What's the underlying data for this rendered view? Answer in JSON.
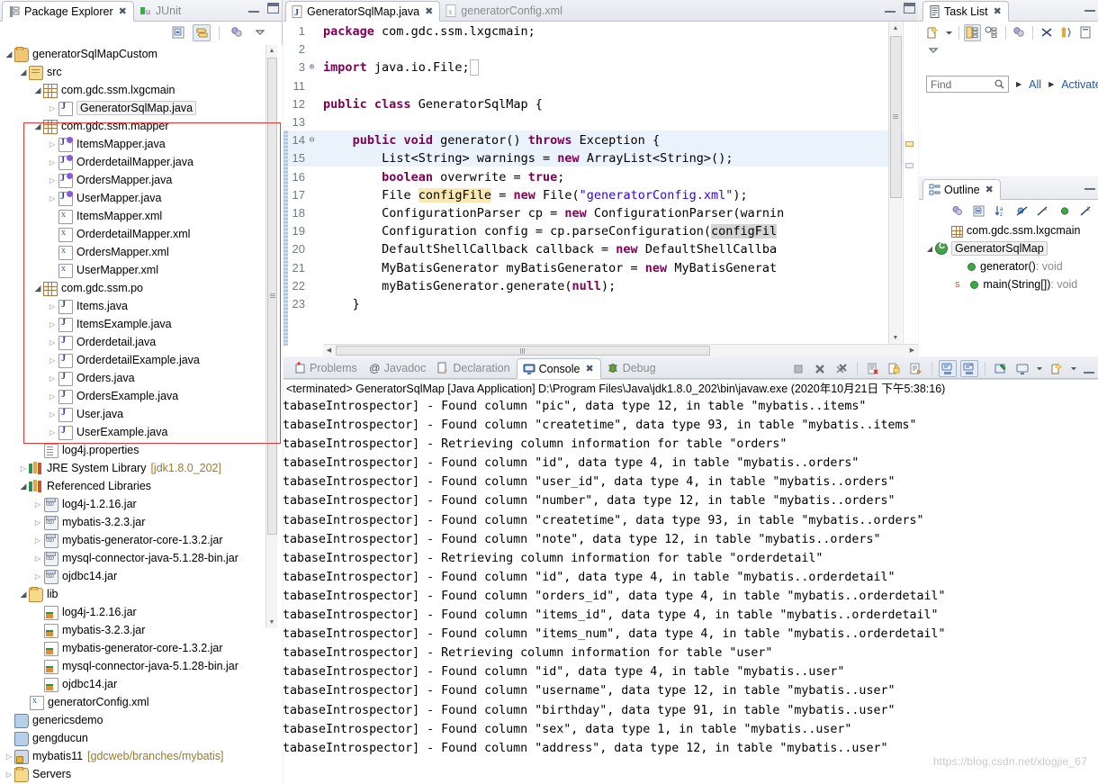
{
  "package_explorer": {
    "tabs": [
      {
        "label": "Package Explorer",
        "icon": "package-explorer-icon",
        "active": true
      },
      {
        "label": "JUnit",
        "icon": "junit-icon",
        "active": false
      }
    ],
    "toolbar": [
      {
        "name": "collapse-all-button",
        "icon": "collapse-all-icon"
      },
      {
        "name": "link-with-editor-button",
        "icon": "link-editor-icon"
      },
      {
        "name": "focus-on-active-task-button",
        "icon": "focus-task-icon"
      },
      {
        "name": "view-menu-button",
        "icon": "chevron-down-icon"
      }
    ],
    "tree": [
      {
        "depth": 0,
        "arrow": "open",
        "icon": "project-icon",
        "label": "generatorSqlMapCustom",
        "sub": ""
      },
      {
        "depth": 1,
        "arrow": "open",
        "icon": "source-folder-icon",
        "label": "src",
        "sub": ""
      },
      {
        "depth": 2,
        "arrow": "open",
        "icon": "package-icon",
        "label": "com.gdc.ssm.lxgcmain",
        "sub": ""
      },
      {
        "depth": 3,
        "arrow": "closed",
        "icon": "java-file-icon",
        "label": "GeneratorSqlMap.java",
        "sub": "",
        "selected": true
      },
      {
        "depth": 2,
        "arrow": "open",
        "icon": "package-icon",
        "label": "com.gdc.ssm.mapper",
        "sub": ""
      },
      {
        "depth": 3,
        "arrow": "closed",
        "icon": "java-interface-icon",
        "label": "ItemsMapper.java",
        "sub": ""
      },
      {
        "depth": 3,
        "arrow": "closed",
        "icon": "java-interface-icon",
        "label": "OrderdetailMapper.java",
        "sub": ""
      },
      {
        "depth": 3,
        "arrow": "closed",
        "icon": "java-interface-icon",
        "label": "OrdersMapper.java",
        "sub": ""
      },
      {
        "depth": 3,
        "arrow": "closed",
        "icon": "java-interface-icon",
        "label": "UserMapper.java",
        "sub": ""
      },
      {
        "depth": 3,
        "arrow": "none",
        "icon": "xml-file-icon",
        "label": "ItemsMapper.xml",
        "sub": ""
      },
      {
        "depth": 3,
        "arrow": "none",
        "icon": "xml-file-icon",
        "label": "OrderdetailMapper.xml",
        "sub": ""
      },
      {
        "depth": 3,
        "arrow": "none",
        "icon": "xml-file-icon",
        "label": "OrdersMapper.xml",
        "sub": ""
      },
      {
        "depth": 3,
        "arrow": "none",
        "icon": "xml-file-icon",
        "label": "UserMapper.xml",
        "sub": ""
      },
      {
        "depth": 2,
        "arrow": "open",
        "icon": "package-icon",
        "label": "com.gdc.ssm.po",
        "sub": ""
      },
      {
        "depth": 3,
        "arrow": "closed",
        "icon": "java-file-icon",
        "label": "Items.java",
        "sub": ""
      },
      {
        "depth": 3,
        "arrow": "closed",
        "icon": "java-file-icon",
        "label": "ItemsExample.java",
        "sub": ""
      },
      {
        "depth": 3,
        "arrow": "closed",
        "icon": "java-file-icon",
        "label": "Orderdetail.java",
        "sub": ""
      },
      {
        "depth": 3,
        "arrow": "closed",
        "icon": "java-file-icon",
        "label": "OrderdetailExample.java",
        "sub": ""
      },
      {
        "depth": 3,
        "arrow": "closed",
        "icon": "java-file-icon",
        "label": "Orders.java",
        "sub": ""
      },
      {
        "depth": 3,
        "arrow": "closed",
        "icon": "java-file-icon",
        "label": "OrdersExample.java",
        "sub": ""
      },
      {
        "depth": 3,
        "arrow": "closed",
        "icon": "java-file-icon",
        "label": "User.java",
        "sub": ""
      },
      {
        "depth": 3,
        "arrow": "closed",
        "icon": "java-file-icon",
        "label": "UserExample.java",
        "sub": ""
      },
      {
        "depth": 2,
        "arrow": "none",
        "icon": "properties-file-icon",
        "label": "log4j.properties",
        "sub": ""
      },
      {
        "depth": 1,
        "arrow": "closed",
        "icon": "library-icon",
        "label": "JRE System Library",
        "sub": "[jdk1.8.0_202]"
      },
      {
        "depth": 1,
        "arrow": "open",
        "icon": "library-icon",
        "label": "Referenced Libraries",
        "sub": ""
      },
      {
        "depth": 2,
        "arrow": "closed",
        "icon": "jar-icon",
        "label": "log4j-1.2.16.jar",
        "sub": ""
      },
      {
        "depth": 2,
        "arrow": "closed",
        "icon": "jar-icon",
        "label": "mybatis-3.2.3.jar",
        "sub": ""
      },
      {
        "depth": 2,
        "arrow": "closed",
        "icon": "jar-icon",
        "label": "mybatis-generator-core-1.3.2.jar",
        "sub": ""
      },
      {
        "depth": 2,
        "arrow": "closed",
        "icon": "jar-icon",
        "label": "mysql-connector-java-5.1.28-bin.jar",
        "sub": ""
      },
      {
        "depth": 2,
        "arrow": "closed",
        "icon": "jar-icon",
        "label": "ojdbc14.jar",
        "sub": ""
      },
      {
        "depth": 1,
        "arrow": "open",
        "icon": "folder-icon",
        "label": "lib",
        "sub": ""
      },
      {
        "depth": 2,
        "arrow": "none",
        "icon": "jar-file-icon",
        "label": "log4j-1.2.16.jar",
        "sub": ""
      },
      {
        "depth": 2,
        "arrow": "none",
        "icon": "jar-file-icon",
        "label": "mybatis-3.2.3.jar",
        "sub": ""
      },
      {
        "depth": 2,
        "arrow": "none",
        "icon": "jar-file-icon",
        "label": "mybatis-generator-core-1.3.2.jar",
        "sub": ""
      },
      {
        "depth": 2,
        "arrow": "none",
        "icon": "jar-file-icon",
        "label": "mysql-connector-java-5.1.28-bin.jar",
        "sub": ""
      },
      {
        "depth": 2,
        "arrow": "none",
        "icon": "jar-file-icon",
        "label": "ojdbc14.jar",
        "sub": ""
      },
      {
        "depth": 1,
        "arrow": "none",
        "icon": "xml-file-icon",
        "label": "generatorConfig.xml",
        "sub": ""
      },
      {
        "depth": 0,
        "arrow": "none",
        "icon": "closed-project-icon",
        "label": "genericsdemo",
        "sub": ""
      },
      {
        "depth": 0,
        "arrow": "none",
        "icon": "closed-project-icon",
        "label": "gengducun",
        "sub": ""
      },
      {
        "depth": 0,
        "arrow": "closed",
        "icon": "svn-project-icon",
        "label": "mybatis11",
        "sub": "[gdcweb/branches/mybatis]"
      },
      {
        "depth": 0,
        "arrow": "closed",
        "icon": "servers-folder-icon",
        "label": "Servers",
        "sub": ""
      }
    ]
  },
  "editor": {
    "tabs": [
      {
        "label": "GeneratorSqlMap.java",
        "icon": "java-file-icon",
        "active": true
      },
      {
        "label": "generatorConfig.xml",
        "icon": "xml-file-icon",
        "active": false
      }
    ],
    "lines": [
      {
        "no": "1",
        "fold": "",
        "text": "package com.gdc.ssm.lxgcmain;"
      },
      {
        "no": "2",
        "fold": "",
        "text": ""
      },
      {
        "no": "3",
        "fold": "+",
        "text": "import java.io.File;"
      },
      {
        "no": "11",
        "fold": "",
        "text": ""
      },
      {
        "no": "12",
        "fold": "",
        "text": "public class GeneratorSqlMap {"
      },
      {
        "no": "13",
        "fold": "",
        "text": ""
      },
      {
        "no": "14",
        "fold": "-",
        "text": "    public void generator() throws Exception {"
      },
      {
        "no": "15",
        "fold": "",
        "text": "        List<String> warnings = new ArrayList<String>();"
      },
      {
        "no": "16",
        "fold": "",
        "text": "        boolean overwrite = true;"
      },
      {
        "no": "17",
        "fold": "",
        "text": "        File configFile = new File(\"generatorConfig.xml\");"
      },
      {
        "no": "18",
        "fold": "",
        "text": "        ConfigurationParser cp = new ConfigurationParser(warnin"
      },
      {
        "no": "19",
        "fold": "",
        "text": "        Configuration config = cp.parseConfiguration(configFil"
      },
      {
        "no": "20",
        "fold": "",
        "text": "        DefaultShellCallback callback = new DefaultShellCallba"
      },
      {
        "no": "21",
        "fold": "",
        "text": "        MyBatisGenerator myBatisGenerator = new MyBatisGenerat"
      },
      {
        "no": "22",
        "fold": "",
        "text": "        myBatisGenerator.generate(null);"
      },
      {
        "no": "23",
        "fold": "",
        "text": "    }"
      }
    ]
  },
  "task_list": {
    "tabs": [
      {
        "label": "Task List",
        "icon": "task-list-icon",
        "active": true
      }
    ],
    "toolbar": [
      {
        "name": "new-task-button",
        "icon": "new-task-icon"
      },
      {
        "name": "new-task-dropdown",
        "icon": "chevron-down-icon"
      },
      {
        "name": "categorized-presentation-button",
        "icon": "categorized-icon"
      },
      {
        "name": "scheduled-presentation-button",
        "icon": "scheduled-icon"
      },
      {
        "name": "focus-on-workweek-button",
        "icon": "focus-workweek-icon"
      },
      {
        "name": "synchronize-changed-button",
        "icon": "synchronize-icon"
      },
      {
        "name": "collapse-all-button",
        "icon": "collapse-all-icon"
      },
      {
        "name": "view-menu-button",
        "icon": "chevron-down-icon"
      }
    ],
    "find_placeholder": "Find",
    "filters": [
      "All",
      "Activate"
    ]
  },
  "outline": {
    "tabs": [
      {
        "label": "Outline",
        "icon": "outline-icon",
        "active": true
      }
    ],
    "toolbar": [
      {
        "name": "focus-active-task-button",
        "icon": "focus-task-icon"
      },
      {
        "name": "collapse-all-button",
        "icon": "collapse-all-icon"
      },
      {
        "name": "sort-button",
        "icon": "sort-az-icon"
      },
      {
        "name": "hide-fields-button",
        "icon": "hide-fields-icon"
      },
      {
        "name": "hide-static-button",
        "icon": "hide-static-icon"
      },
      {
        "name": "hide-nonpublic-button",
        "icon": "hide-nonpublic-icon"
      },
      {
        "name": "hide-local-types-button",
        "icon": "hide-local-icon"
      }
    ],
    "items": [
      {
        "depth": 1,
        "arrow": "none",
        "icon": "package-icon",
        "label": "com.gdc.ssm.lxgcmain",
        "ret": "",
        "sup": ""
      },
      {
        "depth": 0,
        "arrow": "open",
        "icon": "class-icon",
        "label": "GeneratorSqlMap",
        "ret": "",
        "sup": "",
        "selected": true
      },
      {
        "depth": 2,
        "arrow": "none",
        "icon": "method-icon",
        "label": "generator()",
        "ret": " : void",
        "sup": ""
      },
      {
        "depth": 2,
        "arrow": "none",
        "icon": "method-icon",
        "label": "main(String[])",
        "ret": " : void",
        "sup": "S"
      }
    ]
  },
  "console": {
    "tabs": [
      {
        "label": "Problems",
        "icon": "problems-icon",
        "active": false
      },
      {
        "label": "Javadoc",
        "icon": "javadoc-icon",
        "active": false
      },
      {
        "label": "Declaration",
        "icon": "declaration-icon",
        "active": false
      },
      {
        "label": "Console",
        "icon": "console-icon",
        "active": true
      },
      {
        "label": "Debug",
        "icon": "debug-icon",
        "active": false
      }
    ],
    "toolbar": [
      {
        "name": "terminate-button",
        "icon": "terminate-icon"
      },
      {
        "name": "remove-launch-button",
        "icon": "remove-launch-icon"
      },
      {
        "name": "remove-all-terminated-button",
        "icon": "remove-all-icon"
      },
      {
        "name": "clear-console-button",
        "icon": "clear-console-icon"
      },
      {
        "name": "scroll-lock-button",
        "icon": "scroll-lock-icon"
      },
      {
        "name": "word-wrap-button",
        "icon": "word-wrap-icon"
      },
      {
        "name": "show-console-on-output-button",
        "icon": "show-console-out-icon"
      },
      {
        "name": "show-console-on-error-button",
        "icon": "show-console-err-icon"
      },
      {
        "name": "pin-console-button",
        "icon": "pin-console-icon"
      },
      {
        "name": "display-selected-console-button",
        "icon": "display-console-icon"
      },
      {
        "name": "display-selected-console-dropdown",
        "icon": "chevron-down-icon"
      },
      {
        "name": "open-console-button",
        "icon": "open-console-icon"
      },
      {
        "name": "open-console-dropdown",
        "icon": "chevron-down-icon"
      },
      {
        "name": "minimize-button",
        "icon": "minimize-icon"
      }
    ],
    "header": "<terminated> GeneratorSqlMap [Java Application] D:\\Program Files\\Java\\jdk1.8.0_202\\bin\\javaw.exe (2020年10月21日 下午5:38:16)",
    "lines": [
      "tabaseIntrospector] - Found column \"pic\", data type 12, in table \"mybatis..items\"",
      "tabaseIntrospector] - Found column \"createtime\", data type 93, in table \"mybatis..items\"",
      "tabaseIntrospector] - Retrieving column information for table \"orders\"",
      "tabaseIntrospector] - Found column \"id\", data type 4, in table \"mybatis..orders\"",
      "tabaseIntrospector] - Found column \"user_id\", data type 4, in table \"mybatis..orders\"",
      "tabaseIntrospector] - Found column \"number\", data type 12, in table \"mybatis..orders\"",
      "tabaseIntrospector] - Found column \"createtime\", data type 93, in table \"mybatis..orders\"",
      "tabaseIntrospector] - Found column \"note\", data type 12, in table \"mybatis..orders\"",
      "tabaseIntrospector] - Retrieving column information for table \"orderdetail\"",
      "tabaseIntrospector] - Found column \"id\", data type 4, in table \"mybatis..orderdetail\"",
      "tabaseIntrospector] - Found column \"orders_id\", data type 4, in table \"mybatis..orderdetail\"",
      "tabaseIntrospector] - Found column \"items_id\", data type 4, in table \"mybatis..orderdetail\"",
      "tabaseIntrospector] - Found column \"items_num\", data type 4, in table \"mybatis..orderdetail\"",
      "tabaseIntrospector] - Retrieving column information for table \"user\"",
      "tabaseIntrospector] - Found column \"id\", data type 4, in table \"mybatis..user\"",
      "tabaseIntrospector] - Found column \"username\", data type 12, in table \"mybatis..user\"",
      "tabaseIntrospector] - Found column \"birthday\", data type 91, in table \"mybatis..user\"",
      "tabaseIntrospector] - Found column \"sex\", data type 1, in table \"mybatis..user\"",
      "tabaseIntrospector] - Found column \"address\", data type 12, in table \"mybatis..user\""
    ],
    "watermark": "https://blog.csdn.net/xlogjie_67"
  },
  "colors": {
    "keyword": "#7f0055",
    "string": "#2a00ff",
    "accent_link": "#2456a8",
    "highlight_box": "#e53935"
  }
}
